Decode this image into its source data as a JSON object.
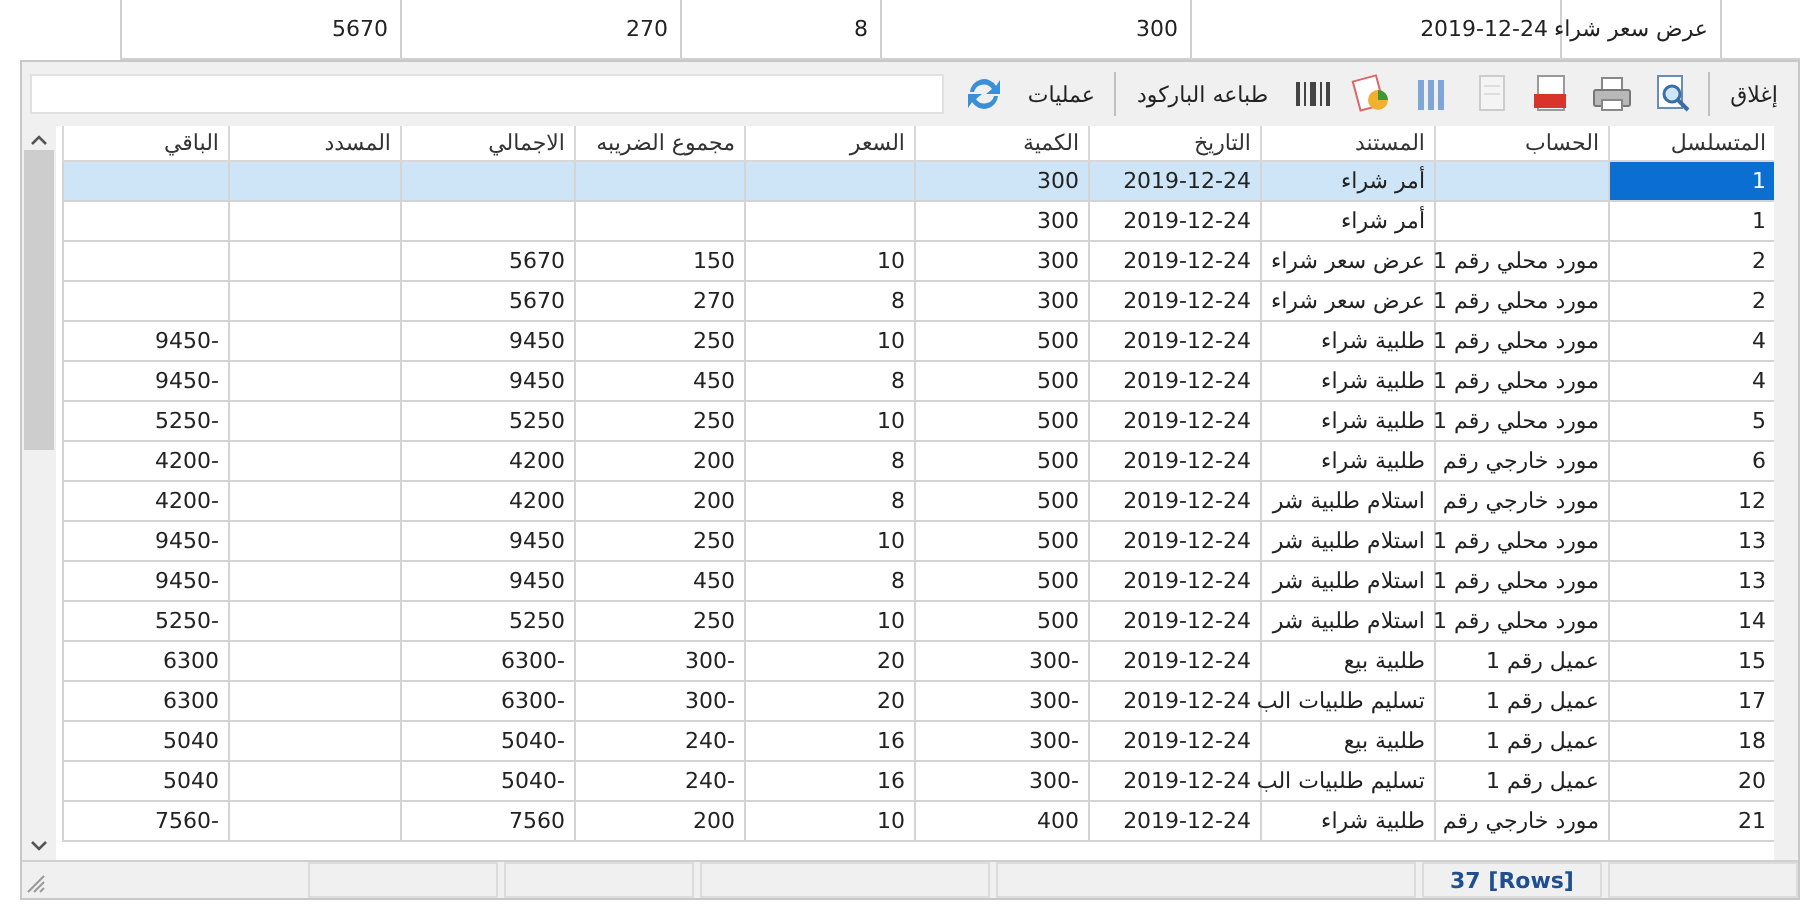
{
  "background_sheet": {
    "row": [
      "عرض سعر شراء",
      "2019-12-24",
      "300",
      "8",
      "270",
      "5670"
    ]
  },
  "toolbar": {
    "close": "إغلاق",
    "barcode_print": "طباعه الباركود",
    "operations": "عمليات"
  },
  "table": {
    "columns": [
      "المتسلسل",
      "الحساب",
      "المستند",
      "التاريخ",
      "الكمية",
      "السعر",
      "مجموع الضريبه",
      "الاجمالي",
      "المسدد",
      "الباقي"
    ],
    "rows": [
      {
        "selected": true,
        "cells": [
          "1",
          null,
          "أمر شراء",
          "2019-12-24",
          "300",
          null,
          null,
          null,
          null,
          null
        ]
      },
      {
        "selected": false,
        "cells": [
          "1",
          null,
          "أمر شراء",
          "2019-12-24",
          "300",
          null,
          null,
          null,
          null,
          null
        ]
      },
      {
        "selected": false,
        "cells": [
          "2",
          "مورد محلي رقم 1",
          "عرض سعر شراء",
          "2019-12-24",
          "300",
          "10",
          "150",
          "5670",
          null,
          null
        ]
      },
      {
        "selected": false,
        "cells": [
          "2",
          "مورد محلي رقم 1",
          "عرض سعر شراء",
          "2019-12-24",
          "300",
          "8",
          "270",
          "5670",
          null,
          null
        ]
      },
      {
        "selected": false,
        "cells": [
          "4",
          "مورد محلي رقم 1",
          "طلبية شراء",
          "2019-12-24",
          "500",
          "10",
          "250",
          "9450",
          null,
          "9450-"
        ]
      },
      {
        "selected": false,
        "cells": [
          "4",
          "مورد محلي رقم 1",
          "طلبية شراء",
          "2019-12-24",
          "500",
          "8",
          "450",
          "9450",
          null,
          "9450-"
        ]
      },
      {
        "selected": false,
        "cells": [
          "5",
          "مورد محلي رقم 1",
          "طلبية شراء",
          "2019-12-24",
          "500",
          "10",
          "250",
          "5250",
          null,
          "5250-"
        ]
      },
      {
        "selected": false,
        "cells": [
          "6",
          "مورد خارجي رقم",
          "طلبية شراء",
          "2019-12-24",
          "500",
          "8",
          "200",
          "4200",
          null,
          "4200-"
        ]
      },
      {
        "selected": false,
        "cells": [
          "12",
          "مورد خارجي رقم",
          "استلام طلبية شر",
          "2019-12-24",
          "500",
          "8",
          "200",
          "4200",
          null,
          "4200-"
        ]
      },
      {
        "selected": false,
        "cells": [
          "13",
          "مورد محلي رقم 1",
          "استلام طلبية شر",
          "2019-12-24",
          "500",
          "10",
          "250",
          "9450",
          null,
          "9450-"
        ]
      },
      {
        "selected": false,
        "cells": [
          "13",
          "مورد محلي رقم 1",
          "استلام طلبية شر",
          "2019-12-24",
          "500",
          "8",
          "450",
          "9450",
          null,
          "9450-"
        ]
      },
      {
        "selected": false,
        "cells": [
          "14",
          "مورد محلي رقم 1",
          "استلام طلبية شر",
          "2019-12-24",
          "500",
          "10",
          "250",
          "5250",
          null,
          "5250-"
        ]
      },
      {
        "selected": false,
        "cells": [
          "15",
          "عميل رقم 1",
          "طلبية بيع",
          "2019-12-24",
          "300-",
          "20",
          "300-",
          "6300-",
          null,
          "6300"
        ]
      },
      {
        "selected": false,
        "cells": [
          "17",
          "عميل رقم 1",
          "تسليم طلبيات الب",
          "2019-12-24",
          "300-",
          "20",
          "300-",
          "6300-",
          null,
          "6300"
        ]
      },
      {
        "selected": false,
        "cells": [
          "18",
          "عميل رقم 1",
          "طلبية بيع",
          "2019-12-24",
          "300-",
          "16",
          "240-",
          "5040-",
          null,
          "5040"
        ]
      },
      {
        "selected": false,
        "cells": [
          "20",
          "عميل رقم 1",
          "تسليم طلبيات الب",
          "2019-12-24",
          "300-",
          "16",
          "240-",
          "5040-",
          null,
          "5040"
        ]
      },
      {
        "selected": false,
        "cells": [
          "21",
          "مورد خارجي رقم",
          "طلبية شراء",
          "2019-12-24",
          "400",
          "10",
          "200",
          "7560",
          null,
          "7560-"
        ]
      }
    ]
  },
  "status_bar": {
    "row_count": "37 [Rows]"
  }
}
